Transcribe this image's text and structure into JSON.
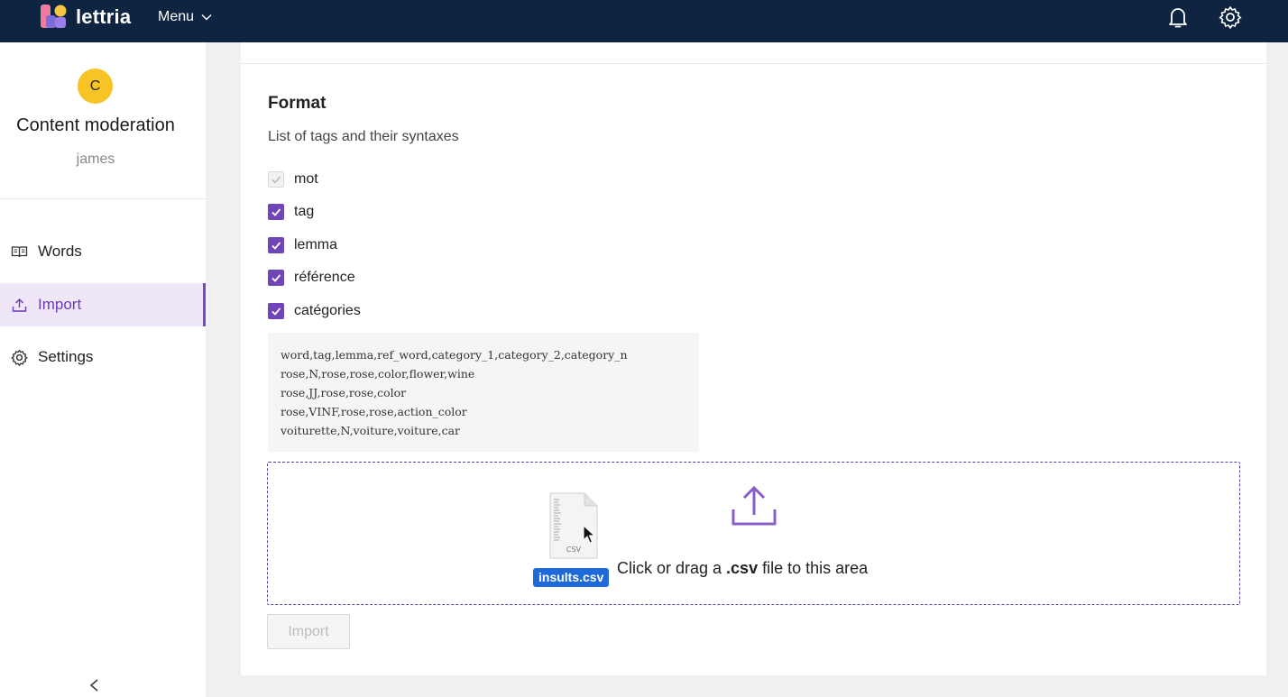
{
  "app": {
    "name": "lettria",
    "menu_label": "Menu"
  },
  "sidebar": {
    "avatar_letter": "C",
    "project_title": "Content moderation",
    "project_user": "james",
    "items": [
      {
        "label": "Words",
        "icon": "book-icon",
        "active": false
      },
      {
        "label": "Import",
        "icon": "upload-icon",
        "active": true
      },
      {
        "label": "Settings",
        "icon": "gear-icon",
        "active": false
      }
    ]
  },
  "format": {
    "title": "Format",
    "subtitle": "List of tags and their syntaxes",
    "checkboxes": [
      {
        "label": "mot",
        "checked": true,
        "disabled": true
      },
      {
        "label": "tag",
        "checked": true,
        "disabled": false
      },
      {
        "label": "lemma",
        "checked": true,
        "disabled": false
      },
      {
        "label": "référence",
        "checked": true,
        "disabled": false
      },
      {
        "label": "catégories",
        "checked": true,
        "disabled": false
      }
    ],
    "code_lines": [
      "word,tag,lemma,ref_word,category_1,category_2,category_n",
      "rose,N,rose,rose,color,flower,wine",
      "rose,JJ,rose,rose,color",
      "rose,VINF,rose,rose,action_color",
      "voiturette,N,voiture,voiture,car"
    ]
  },
  "dropzone": {
    "text_before": "Click or drag a ",
    "text_bold": ".csv",
    "text_after": " file to this area",
    "dragged_file": "insults.csv",
    "file_badge": "CSV"
  },
  "actions": {
    "import_label": "Import"
  },
  "colors": {
    "topbar": "#0e2440",
    "accent": "#6f45b7",
    "avatar": "#f7c325",
    "file_label": "#1d6ad8"
  }
}
